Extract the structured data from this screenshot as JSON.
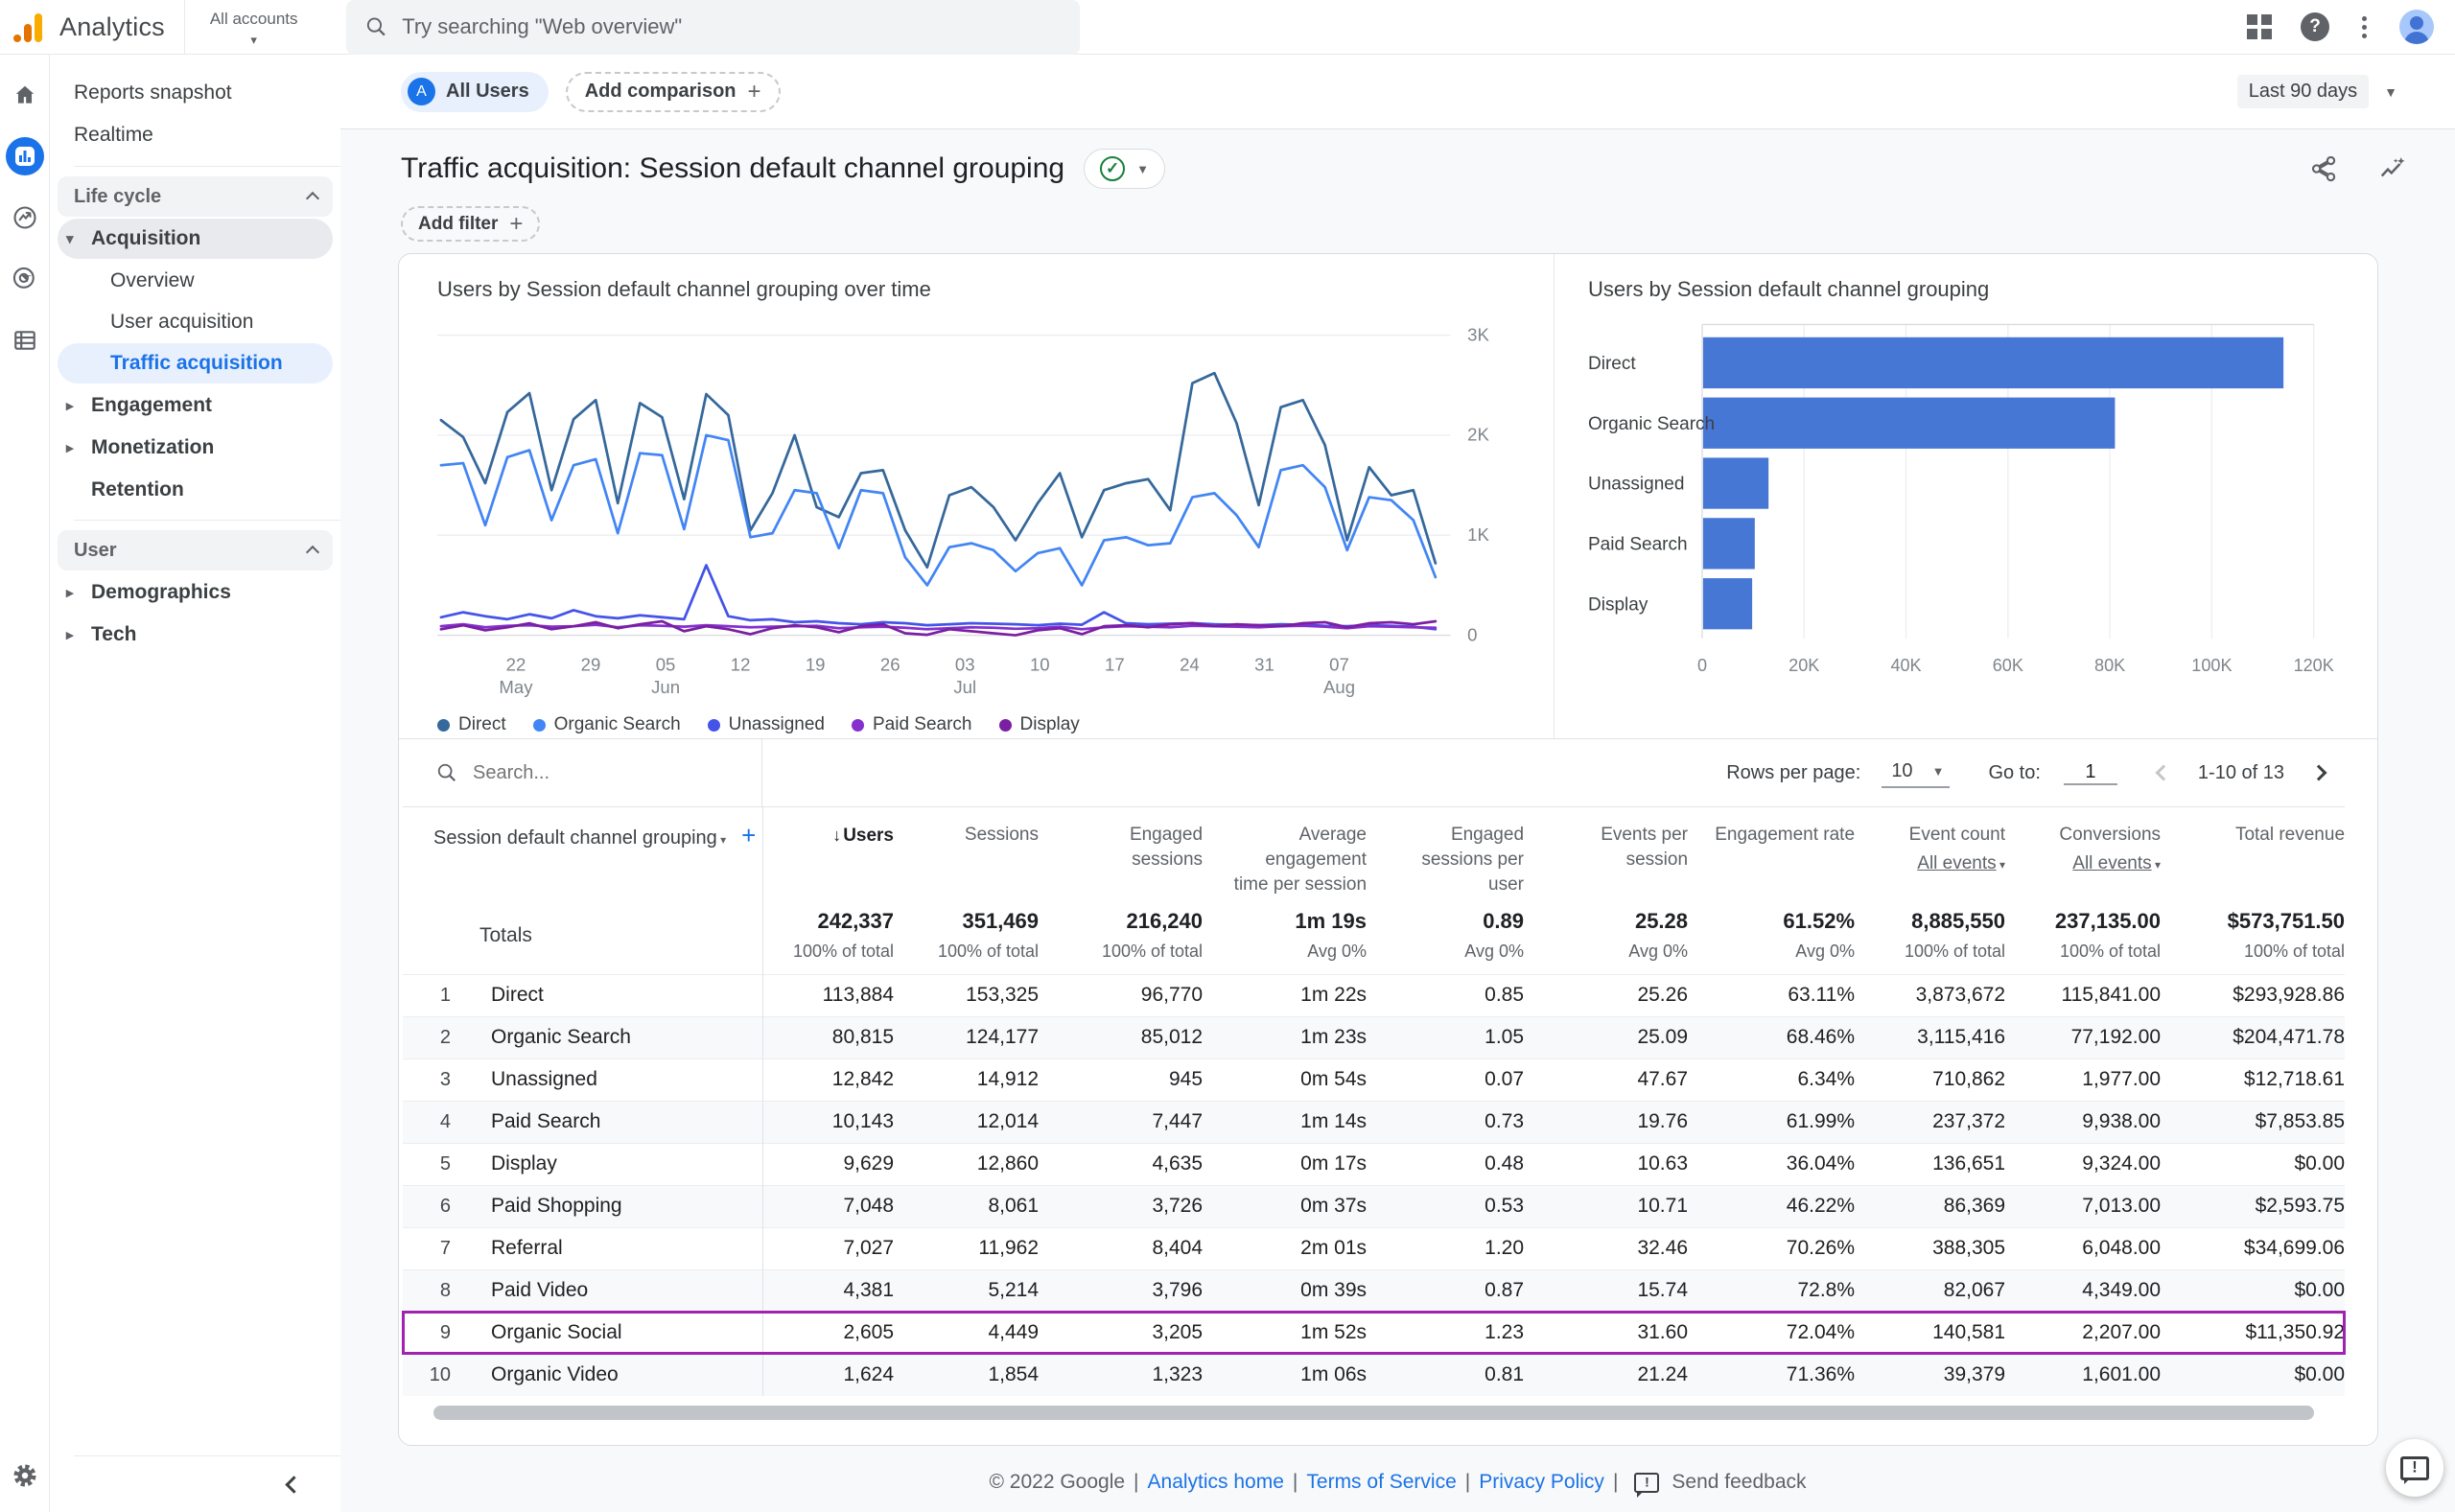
{
  "app_bar": {
    "product_name": "Analytics",
    "accounts_label": "All accounts",
    "search_placeholder": "Try searching \"Web overview\"",
    "avatar_letter": ""
  },
  "report_header": {
    "comparison_avatar": "A",
    "comparison_chip": "All Users",
    "add_comparison_label": "Add comparison",
    "date_range": "Last 90 days",
    "title": "Traffic acquisition: Session default channel grouping",
    "badge_check": "✓",
    "add_filter_label": "Add filter"
  },
  "nav": {
    "top_items": [
      {
        "label": "Reports snapshot"
      },
      {
        "label": "Realtime"
      }
    ],
    "sections": [
      {
        "label": "Life cycle",
        "groups": [
          {
            "label": "Acquisition",
            "state": "expanded",
            "children": [
              {
                "label": "Overview",
                "active": false
              },
              {
                "label": "User acquisition",
                "active": false
              },
              {
                "label": "Traffic acquisition",
                "active": true
              }
            ]
          },
          {
            "label": "Engagement",
            "state": "collapsed"
          },
          {
            "label": "Monetization",
            "state": "collapsed"
          },
          {
            "label": "Retention",
            "state": "leaf"
          }
        ]
      },
      {
        "label": "User",
        "groups": [
          {
            "label": "Demographics",
            "state": "collapsed"
          },
          {
            "label": "Tech",
            "state": "collapsed"
          }
        ]
      }
    ]
  },
  "chart_data": [
    {
      "type": "line",
      "title": "Users by Session default channel grouping over time",
      "ylabel": "Users",
      "ylim": [
        0,
        3000
      ],
      "yticks": [
        {
          "label": "0",
          "value": 0
        },
        {
          "label": "1K",
          "value": 1000
        },
        {
          "label": "2K",
          "value": 2000
        },
        {
          "label": "3K",
          "value": 3000
        }
      ],
      "span_days": 93,
      "xticks": [
        {
          "day": 7,
          "label": "22",
          "month": "May"
        },
        {
          "day": 14,
          "label": "29",
          "month": ""
        },
        {
          "day": 21,
          "label": "05",
          "month": "Jun"
        },
        {
          "day": 28,
          "label": "12",
          "month": ""
        },
        {
          "day": 35,
          "label": "19",
          "month": ""
        },
        {
          "day": 42,
          "label": "26",
          "month": ""
        },
        {
          "day": 49,
          "label": "03",
          "month": "Jul"
        },
        {
          "day": 56,
          "label": "10",
          "month": ""
        },
        {
          "day": 63,
          "label": "17",
          "month": ""
        },
        {
          "day": 70,
          "label": "24",
          "month": ""
        },
        {
          "day": 77,
          "label": "31",
          "month": ""
        },
        {
          "day": 84,
          "label": "07",
          "month": "Aug"
        }
      ],
      "legend_position": "bottom",
      "series": [
        {
          "name": "Direct",
          "color": "#35689b",
          "values": [
            2150,
            1980,
            1520,
            2230,
            2420,
            1450,
            2160,
            2350,
            1320,
            2320,
            2180,
            1360,
            2410,
            2200,
            1050,
            1420,
            2000,
            1280,
            1180,
            1620,
            1650,
            1050,
            680,
            1400,
            1480,
            1280,
            950,
            1320,
            1620,
            980,
            1450,
            1520,
            1560,
            1250,
            2520,
            2620,
            2120,
            1300,
            2280,
            2350,
            1900,
            950,
            1680,
            1400,
            1450,
            720
          ]
        },
        {
          "name": "Organic Search",
          "color": "#4285f4",
          "values": [
            1700,
            1720,
            1100,
            1780,
            1850,
            1150,
            1700,
            1760,
            1020,
            1820,
            1800,
            1060,
            2000,
            1950,
            980,
            1020,
            1450,
            1420,
            870,
            1450,
            1420,
            780,
            500,
            880,
            920,
            850,
            640,
            820,
            870,
            500,
            950,
            980,
            900,
            920,
            1380,
            1420,
            1200,
            880,
            1650,
            1700,
            1480,
            850,
            1380,
            1350,
            1150,
            580
          ]
        },
        {
          "name": "Unassigned",
          "color": "#4453e8",
          "values": [
            180,
            230,
            190,
            160,
            210,
            170,
            250,
            190,
            170,
            200,
            180,
            160,
            700,
            190,
            150,
            160,
            130,
            140,
            120,
            110,
            130,
            120,
            100,
            110,
            120,
            115,
            110,
            100,
            115,
            105,
            230,
            120,
            110,
            115,
            120,
            110,
            105,
            100,
            110,
            105,
            95,
            90,
            100,
            95,
            85,
            60
          ]
        },
        {
          "name": "Paid Search",
          "color": "#8430ce",
          "values": [
            90,
            110,
            80,
            95,
            100,
            85,
            90,
            105,
            80,
            100,
            95,
            85,
            100,
            90,
            80,
            85,
            90,
            95,
            70,
            80,
            85,
            75,
            60,
            70,
            80,
            75,
            65,
            70,
            85,
            60,
            80,
            90,
            85,
            80,
            95,
            90,
            85,
            80,
            90,
            95,
            85,
            70,
            90,
            85,
            80,
            75
          ]
        },
        {
          "name": "Display",
          "color": "#7b1fa2",
          "values": [
            60,
            100,
            50,
            80,
            120,
            60,
            90,
            130,
            70,
            110,
            140,
            40,
            90,
            60,
            10,
            70,
            100,
            80,
            30,
            90,
            110,
            20,
            5,
            60,
            40,
            20,
            0,
            50,
            70,
            10,
            90,
            100,
            80,
            110,
            120,
            90,
            110,
            100,
            90,
            120,
            130,
            80,
            120,
            130,
            110,
            140
          ]
        }
      ]
    },
    {
      "type": "bar",
      "orientation": "horizontal",
      "title": "Users by Session default channel grouping",
      "categories": [
        "Direct",
        "Organic Search",
        "Unassigned",
        "Paid Search",
        "Display"
      ],
      "values": [
        113884,
        80815,
        12842,
        10143,
        9629
      ],
      "xlim": [
        0,
        120000
      ],
      "xticks": [
        "0",
        "20K",
        "40K",
        "60K",
        "80K",
        "100K",
        "120K"
      ],
      "bar_color": "#4677d4",
      "grid": true
    }
  ],
  "table": {
    "search_placeholder": "Search...",
    "rows_per_page_label": "Rows per page:",
    "rows_per_page_value": "10",
    "goto_label": "Go to:",
    "goto_value": "1",
    "range_label": "1-10 of 13",
    "dimension_header": "Session default channel grouping",
    "columns": [
      {
        "label": "Users",
        "sorted": true
      },
      {
        "label": "Sessions"
      },
      {
        "label": "Engaged\nsessions"
      },
      {
        "label": "Average\nengagement\ntime per session"
      },
      {
        "label": "Engaged\nsessions per\nuser"
      },
      {
        "label": "Events per\nsession"
      },
      {
        "label": "Engagement rate"
      },
      {
        "label": "Event count",
        "sublabel": "All events"
      },
      {
        "label": "Conversions",
        "sublabel": "All events"
      },
      {
        "label": "Total revenue"
      }
    ],
    "totals": {
      "label": "Totals",
      "values": [
        "242,337",
        "351,469",
        "216,240",
        "1m 19s",
        "0.89",
        "25.28",
        "61.52%",
        "8,885,550",
        "237,135.00",
        "$573,751.50"
      ],
      "subvalues": [
        "100% of total",
        "100% of total",
        "100% of total",
        "Avg 0%",
        "Avg 0%",
        "Avg 0%",
        "Avg 0%",
        "100% of total",
        "100% of total",
        "100% of total"
      ]
    },
    "rows": [
      {
        "n": "1",
        "channel": "Direct",
        "cells": [
          "113,884",
          "153,325",
          "96,770",
          "1m 22s",
          "0.85",
          "25.26",
          "63.11%",
          "3,873,672",
          "115,841.00",
          "$293,928.86"
        ]
      },
      {
        "n": "2",
        "channel": "Organic Search",
        "cells": [
          "80,815",
          "124,177",
          "85,012",
          "1m 23s",
          "1.05",
          "25.09",
          "68.46%",
          "3,115,416",
          "77,192.00",
          "$204,471.78"
        ]
      },
      {
        "n": "3",
        "channel": "Unassigned",
        "cells": [
          "12,842",
          "14,912",
          "945",
          "0m 54s",
          "0.07",
          "47.67",
          "6.34%",
          "710,862",
          "1,977.00",
          "$12,718.61"
        ]
      },
      {
        "n": "4",
        "channel": "Paid Search",
        "cells": [
          "10,143",
          "12,014",
          "7,447",
          "1m 14s",
          "0.73",
          "19.76",
          "61.99%",
          "237,372",
          "9,938.00",
          "$7,853.85"
        ]
      },
      {
        "n": "5",
        "channel": "Display",
        "cells": [
          "9,629",
          "12,860",
          "4,635",
          "0m 17s",
          "0.48",
          "10.63",
          "36.04%",
          "136,651",
          "9,324.00",
          "$0.00"
        ]
      },
      {
        "n": "6",
        "channel": "Paid Shopping",
        "cells": [
          "7,048",
          "8,061",
          "3,726",
          "0m 37s",
          "0.53",
          "10.71",
          "46.22%",
          "86,369",
          "7,013.00",
          "$2,593.75"
        ]
      },
      {
        "n": "7",
        "channel": "Referral",
        "cells": [
          "7,027",
          "11,962",
          "8,404",
          "2m 01s",
          "1.20",
          "32.46",
          "70.26%",
          "388,305",
          "6,048.00",
          "$34,699.06"
        ]
      },
      {
        "n": "8",
        "channel": "Paid Video",
        "cells": [
          "4,381",
          "5,214",
          "3,796",
          "0m 39s",
          "0.87",
          "15.74",
          "72.8%",
          "82,067",
          "4,349.00",
          "$0.00"
        ]
      },
      {
        "n": "9",
        "channel": "Organic Social",
        "highlighted": true,
        "cells": [
          "2,605",
          "4,449",
          "3,205",
          "1m 52s",
          "1.23",
          "31.60",
          "72.04%",
          "140,581",
          "2,207.00",
          "$11,350.92"
        ]
      },
      {
        "n": "10",
        "channel": "Organic Video",
        "cells": [
          "1,624",
          "1,854",
          "1,323",
          "1m 06s",
          "0.81",
          "21.24",
          "71.36%",
          "39,379",
          "1,601.00",
          "$0.00"
        ]
      }
    ],
    "highlight_color": "#a122af"
  },
  "footer": {
    "copyright": "© 2022 Google",
    "separator": "|",
    "links": [
      "Analytics home",
      "Terms of Service",
      "Privacy Policy"
    ],
    "send_feedback": "Send feedback"
  }
}
